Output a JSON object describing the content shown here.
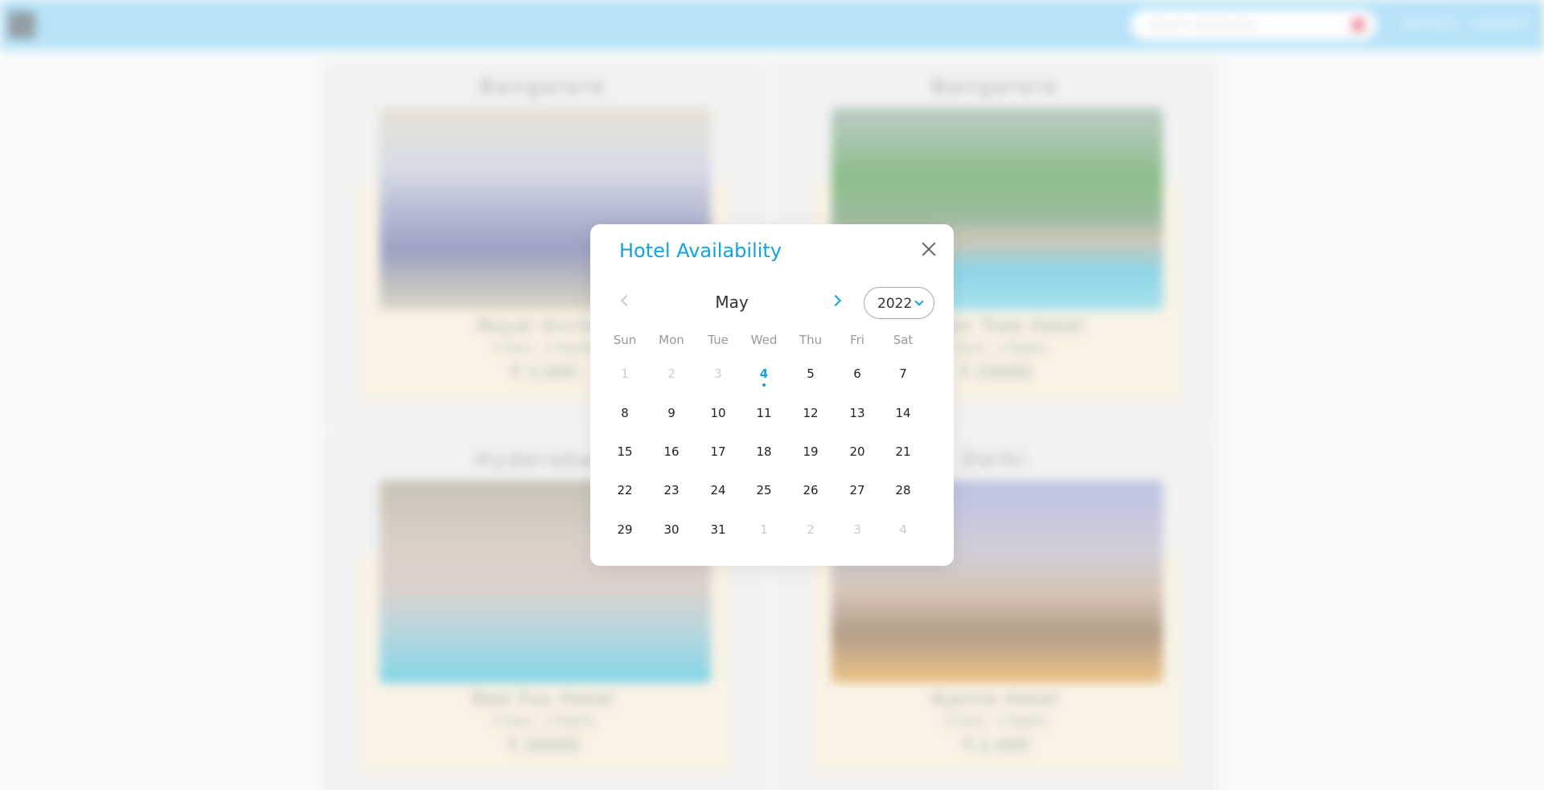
{
  "header": {
    "search_placeholder": "Search hotels/city",
    "nav": {
      "hotels": "HOTELS",
      "logout": "LOGOUT"
    }
  },
  "hotels": [
    {
      "city": "Bangalore",
      "name": "Royal Orchid",
      "duration": "2 Days - 2 Nights",
      "price": "₹ 3,000"
    },
    {
      "city": "Bangalore",
      "name": "Lemon Tree Hotel",
      "duration": "2 Days - 2 Nights",
      "price": "₹ 20000"
    },
    {
      "city": "Hyderabad",
      "name": "Red Fox Hotel",
      "duration": "2 Days - 2 Nights",
      "price": "₹ 30000"
    },
    {
      "city": "Delhi",
      "name": "Ajanta Hotel",
      "duration": "2 Days - 2 Nights",
      "price": "₹ 2,400"
    }
  ],
  "modal": {
    "title": "Hotel Availability",
    "month": "May",
    "year": "2022",
    "weekdays": [
      "Sun",
      "Mon",
      "Tue",
      "Wed",
      "Thu",
      "Fri",
      "Sat"
    ],
    "days": [
      "1",
      "2",
      "3",
      "4",
      "5",
      "6",
      "7",
      "8",
      "9",
      "10",
      "11",
      "12",
      "13",
      "14",
      "15",
      "16",
      "17",
      "18",
      "19",
      "20",
      "21",
      "22",
      "23",
      "24",
      "25",
      "26",
      "27",
      "28",
      "29",
      "30",
      "31",
      "1",
      "2",
      "3",
      "4"
    ],
    "today": "4"
  },
  "colors": {
    "accent": "#11a4dd",
    "header": "#92d5f5",
    "card_info": "#f6edd9"
  }
}
